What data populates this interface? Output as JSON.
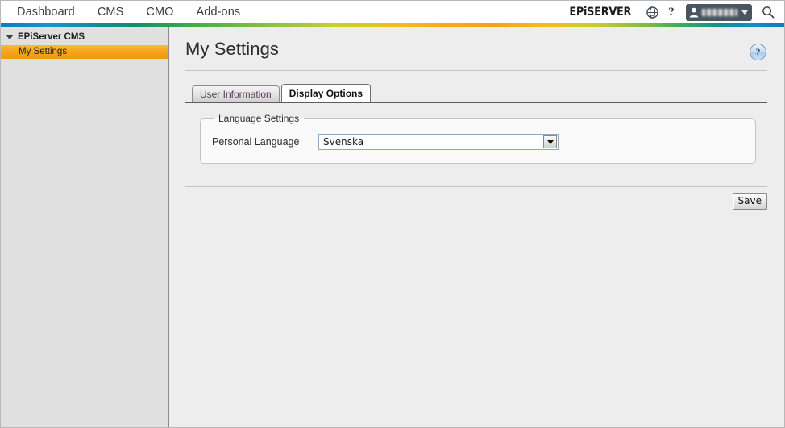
{
  "header": {
    "nav": [
      {
        "label": "Dashboard",
        "name": "nav-dashboard"
      },
      {
        "label": "CMS",
        "name": "nav-cms"
      },
      {
        "label": "CMO",
        "name": "nav-cmo"
      },
      {
        "label": "Add-ons",
        "name": "nav-addons"
      }
    ],
    "brand": {
      "prefix": "EP",
      "i": "i",
      "suffix": "SERVER"
    },
    "help_symbol": "?",
    "user": {
      "name_masked": ""
    },
    "icons": {
      "globe": "globe-icon",
      "help": "question-mark-icon",
      "person": "person-icon",
      "caret": "chevron-down-icon",
      "search": "search-icon"
    }
  },
  "sidebar": {
    "root": {
      "label": "EPiServer CMS"
    },
    "items": [
      {
        "label": "My Settings",
        "selected": true
      }
    ]
  },
  "main": {
    "title": "My Settings",
    "help_symbol": "?",
    "tabs": [
      {
        "label": "User Information",
        "active": false
      },
      {
        "label": "Display Options",
        "active": true
      }
    ],
    "fieldset": {
      "legend": "Language Settings",
      "field": {
        "label": "Personal Language",
        "value": "Svenska",
        "options": [
          "Svenska"
        ]
      }
    },
    "save_label": "Save"
  },
  "colors": {
    "accent_orange": "#f5a51c",
    "sidebar_bg": "#e0e0e0",
    "content_bg": "#ededed",
    "user_chip": "#4a5560"
  }
}
